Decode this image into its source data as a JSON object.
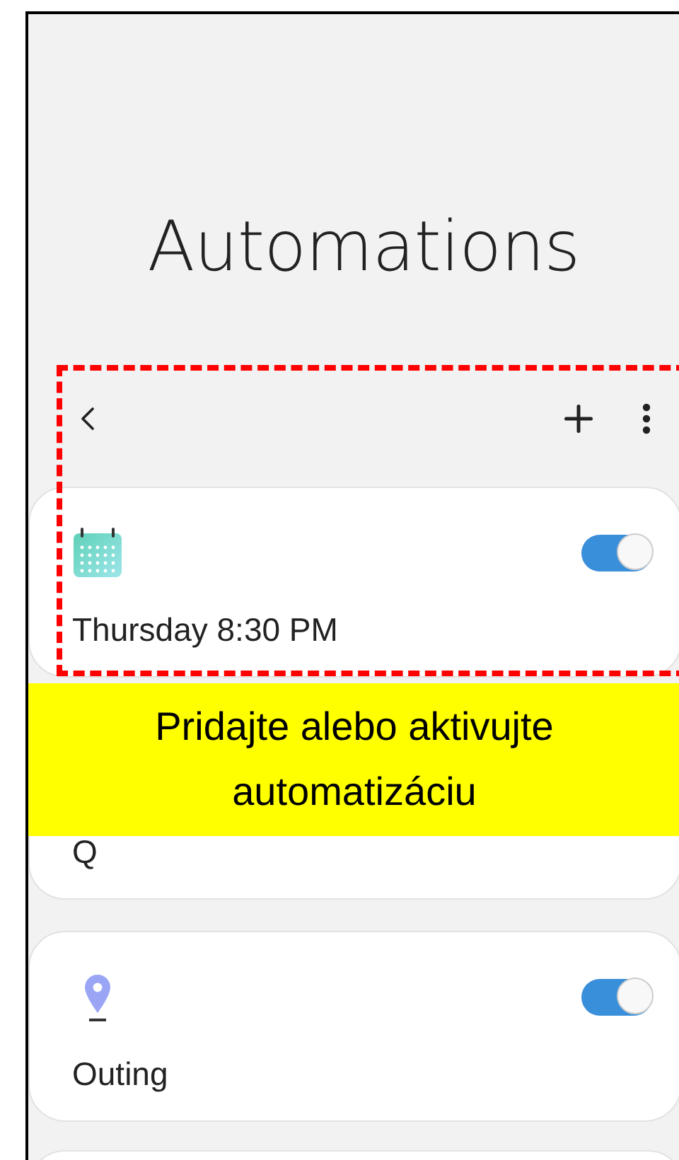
{
  "title": "Automations",
  "automations": [
    {
      "kind": "calendar",
      "name": "Thursday 8:30 PM",
      "on": true
    },
    {
      "name": "Q"
    },
    {
      "kind": "location",
      "name": "Outing",
      "on": true
    }
  ],
  "banner": {
    "text": "Pridajte alebo aktivujte automatizáciu"
  }
}
